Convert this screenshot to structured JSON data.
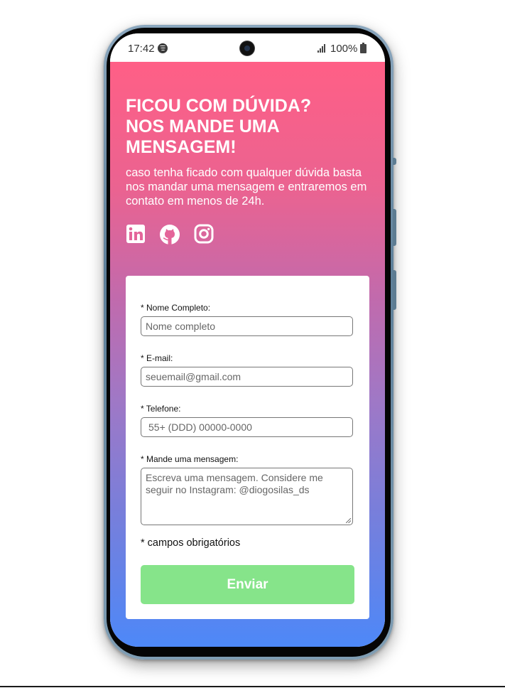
{
  "status_bar": {
    "time": "17:42",
    "battery": "100%",
    "icons": [
      "spotify-icon",
      "camera-icon",
      "signal-icon",
      "battery-icon"
    ]
  },
  "hero": {
    "headline": "FICOU COM DÚVIDA? NOS MANDE UMA MENSAGEM!",
    "subtitle": "caso tenha ficado com qualquer dúvida basta nos mandar uma mensagem e entraremos em contato em menos de 24h.",
    "social_icons": [
      "linkedin-icon",
      "github-icon",
      "instagram-icon"
    ]
  },
  "form": {
    "name_label": "* Nome Completo:",
    "name_placeholder": "Nome completo",
    "email_label": "* E-mail:",
    "email_placeholder": "seuemail@gmail.com",
    "phone_label": "* Telefone:",
    "phone_placeholder": "55+ (DDD) 00000-0000",
    "message_label": "* Mande uma mensagem:",
    "message_placeholder": "Escreva uma mensagem. Considere me seguir no Instagram: @diogosilas_ds",
    "required_note": "* campos obrigatórios",
    "submit_label": "Enviar"
  },
  "colors": {
    "gradient_top": "#ff5f86",
    "gradient_bottom": "#4d88f8",
    "submit_button": "#86e48a"
  }
}
